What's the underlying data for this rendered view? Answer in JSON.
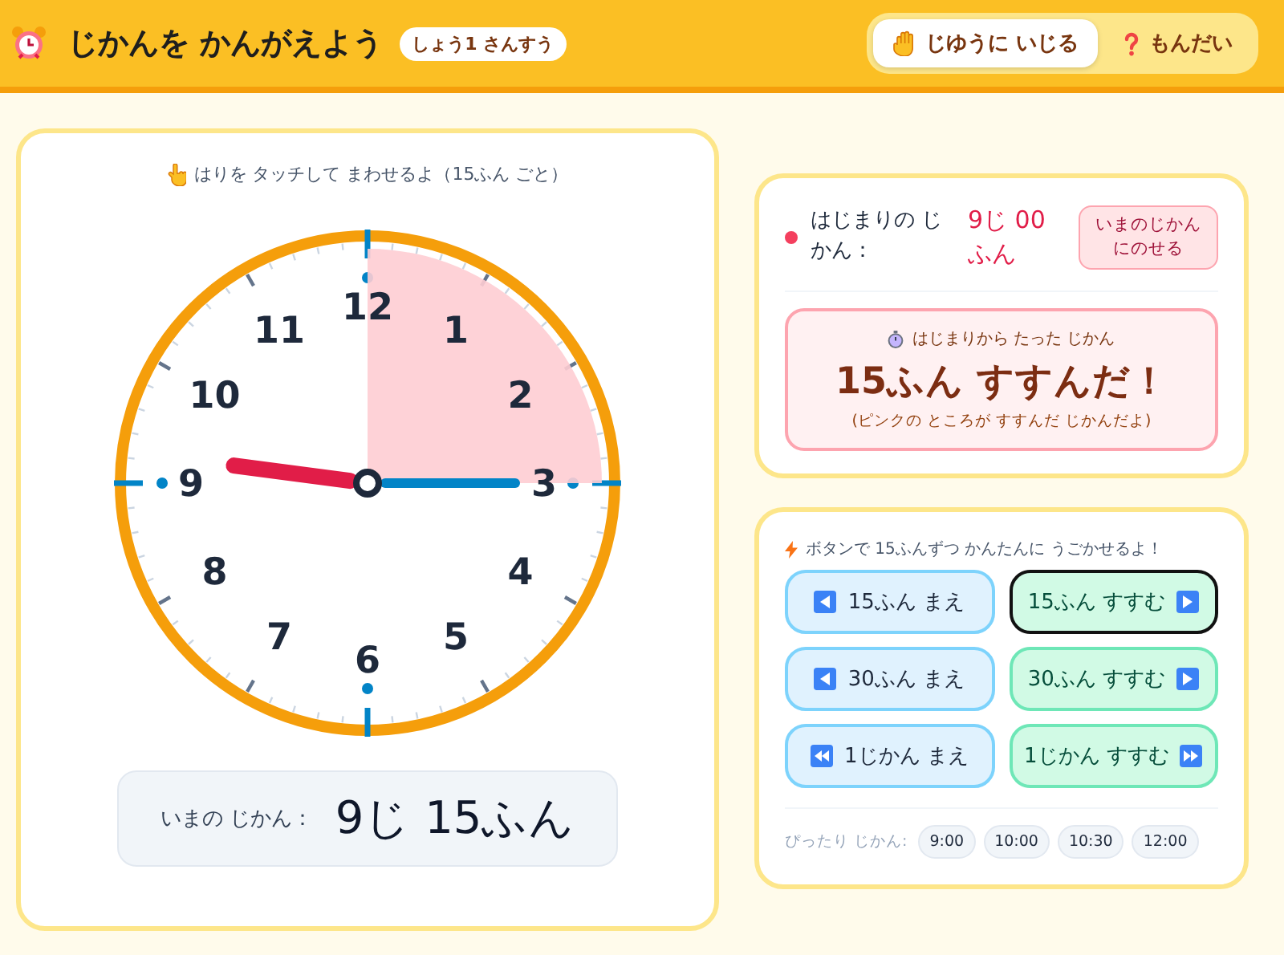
{
  "header": {
    "title": "じかんを かんがえよう",
    "badge": "しょう1 さんすう",
    "modes": [
      {
        "label": "じゆうに いじる",
        "kind": "hand",
        "selected": true
      },
      {
        "label": "もんだい",
        "kind": "question",
        "selected": false
      }
    ]
  },
  "clock_card": {
    "hint": "はりを タッチして まわせるよ（15ふん ごと）",
    "numbers": [
      "12",
      "1",
      "2",
      "3",
      "4",
      "5",
      "6",
      "7",
      "8",
      "9",
      "10",
      "11"
    ],
    "current_label": "いまの じかん：",
    "current_time": "9じ 15ふん"
  },
  "start_card": {
    "label": "はじまりの じかん：",
    "time": "9じ 00ふん",
    "set_button": "いまのじかんにのせる",
    "elapsed_caption": "はじまりから たった じかん",
    "elapsed": "15ふん すすんだ！",
    "elapsed_note": "(ピンクの ところが すすんだ じかんだよ)"
  },
  "controls_card": {
    "hint": "ボタンで 15ふんずつ かんたんに うごかせるよ！",
    "buttons": [
      {
        "label": "15ふん まえ",
        "kind": "back",
        "focused": false
      },
      {
        "label": "15ふん すすむ",
        "kind": "forward",
        "focused": true
      },
      {
        "label": "30ふん まえ",
        "kind": "back",
        "focused": false
      },
      {
        "label": "30ふん すすむ",
        "kind": "forward",
        "focused": false
      },
      {
        "label": "1じかん まえ",
        "kind": "fast_back",
        "focused": false
      },
      {
        "label": "1じかん すすむ",
        "kind": "fast_forward",
        "focused": false
      }
    ],
    "presets_label": "ぴったり じかん:",
    "presets": [
      "9:00",
      "10:00",
      "10:30",
      "12:00"
    ]
  }
}
